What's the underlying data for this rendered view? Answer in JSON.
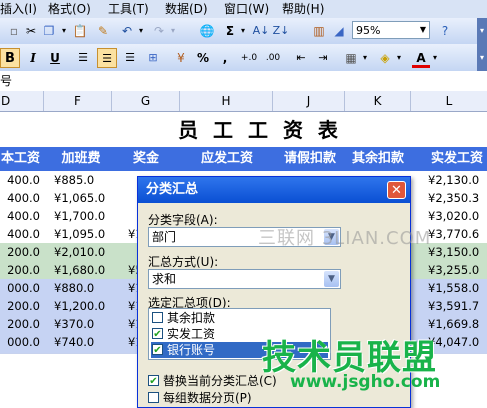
{
  "menubar": {
    "items": [
      "插入(I)",
      "格式(O)",
      "工具(T)",
      "数据(D)",
      "窗口(W)",
      "帮助(H)"
    ]
  },
  "toolbar": {
    "zoom_value": "95%",
    "bold": "B",
    "italic": "I",
    "underline": "U",
    "currency_symbol": "¥",
    "percent_symbol": "%",
    "comma_symbol": ",",
    "sum_symbol": "Σ",
    "font_color_symbol": "A"
  },
  "formula_bar": {
    "name_box_text": "号"
  },
  "columns": [
    "D",
    "F",
    "G",
    "H",
    "J",
    "K",
    "L"
  ],
  "sheet": {
    "title": "员 工 工 资 表",
    "headers": [
      "本工资",
      "加班费",
      "奖金",
      "应发工资",
      "请假扣款",
      "其余扣款",
      "实发工资"
    ],
    "rows": [
      {
        "d": "400.0",
        "f": "¥885.0",
        "g": "",
        "l": "¥2,130.0"
      },
      {
        "d": "400.0",
        "f": "¥1,065.0",
        "g": "",
        "l": "¥2,350.3"
      },
      {
        "d": "400.0",
        "f": "¥1,700.0",
        "g": "",
        "l": "¥3,020.0"
      },
      {
        "d": "400.0",
        "f": "¥1,095.0",
        "g": "¥1",
        "l": "¥3,770.6"
      },
      {
        "d": "200.0",
        "f": "¥2,010.0",
        "g": "",
        "l": "¥3,150.0"
      },
      {
        "d": "200.0",
        "f": "¥1,680.0",
        "g": "¥5",
        "l": "¥3,255.0"
      },
      {
        "d": "000.0",
        "f": "¥880.0",
        "g": "¥1",
        "l": "¥1,558.0"
      },
      {
        "d": "200.0",
        "f": "¥1,200.0",
        "g": "¥1",
        "l": "¥3,591.7"
      },
      {
        "d": "200.0",
        "f": "¥370.0",
        "g": "¥1",
        "l": "¥1,669.8"
      },
      {
        "d": "000.0",
        "f": "¥740.0",
        "g": "¥1",
        "l": "¥4,047.0"
      }
    ]
  },
  "dialog": {
    "title": "分类汇总",
    "close_symbol": "✕",
    "group_field_label": "分类字段(A):",
    "group_field_value": "部门",
    "function_label": "汇总方式(U):",
    "function_value": "求和",
    "items_label": "选定汇总项(D):",
    "items": [
      {
        "label": "其余扣款",
        "checked": false
      },
      {
        "label": "实发工资",
        "checked": true
      },
      {
        "label": "银行账号",
        "checked": true
      }
    ],
    "replace_label": "替换当前分类汇总(C)",
    "pagebreak_label": "每组数据分页(P)"
  },
  "watermarks": {
    "w1": "三联网 3LIAN.COM",
    "w2": "技术员联盟",
    "w3": "www.jsgho.com"
  }
}
